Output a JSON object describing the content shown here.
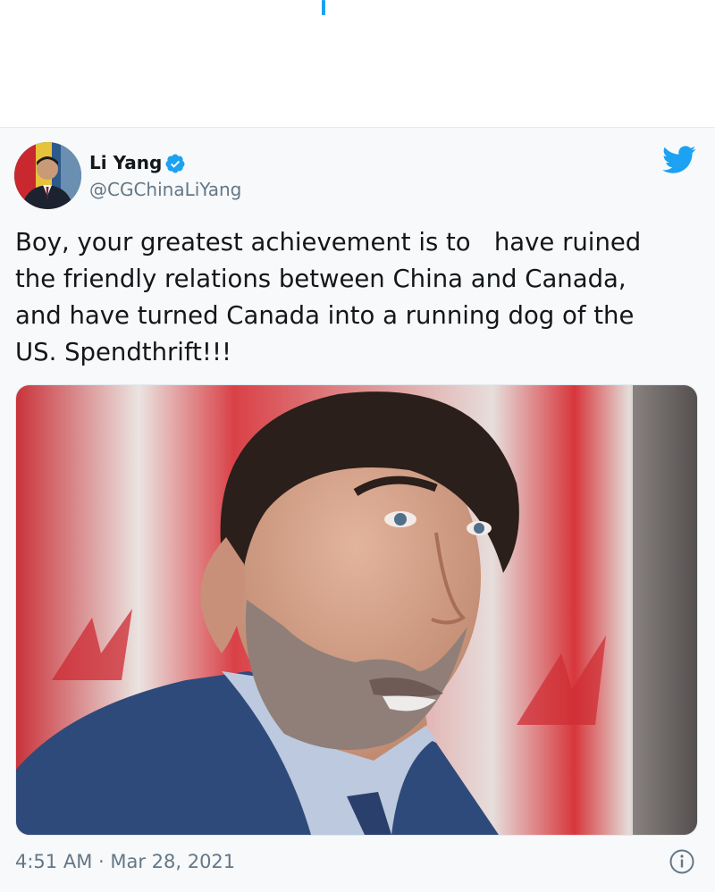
{
  "tweet": {
    "author": {
      "name": "Li Yang",
      "handle": "@CGChinaLiYang",
      "verified": true
    },
    "text": "Boy, your greatest achievement is to   have ruined\nthe friendly relations between China and Canada,\nand have turned Canada into a running dog of the\nUS. Spendthrift!!!",
    "timestamp": "4:51 AM · Mar 28, 2021"
  },
  "icons": {
    "verified": "verified-badge-icon",
    "brand": "twitter-bird-icon",
    "info": "info-icon"
  },
  "colors": {
    "accent": "#1da1f2",
    "text_primary": "#14171a",
    "text_secondary": "#657786",
    "card_background": "#f7f9fa"
  }
}
